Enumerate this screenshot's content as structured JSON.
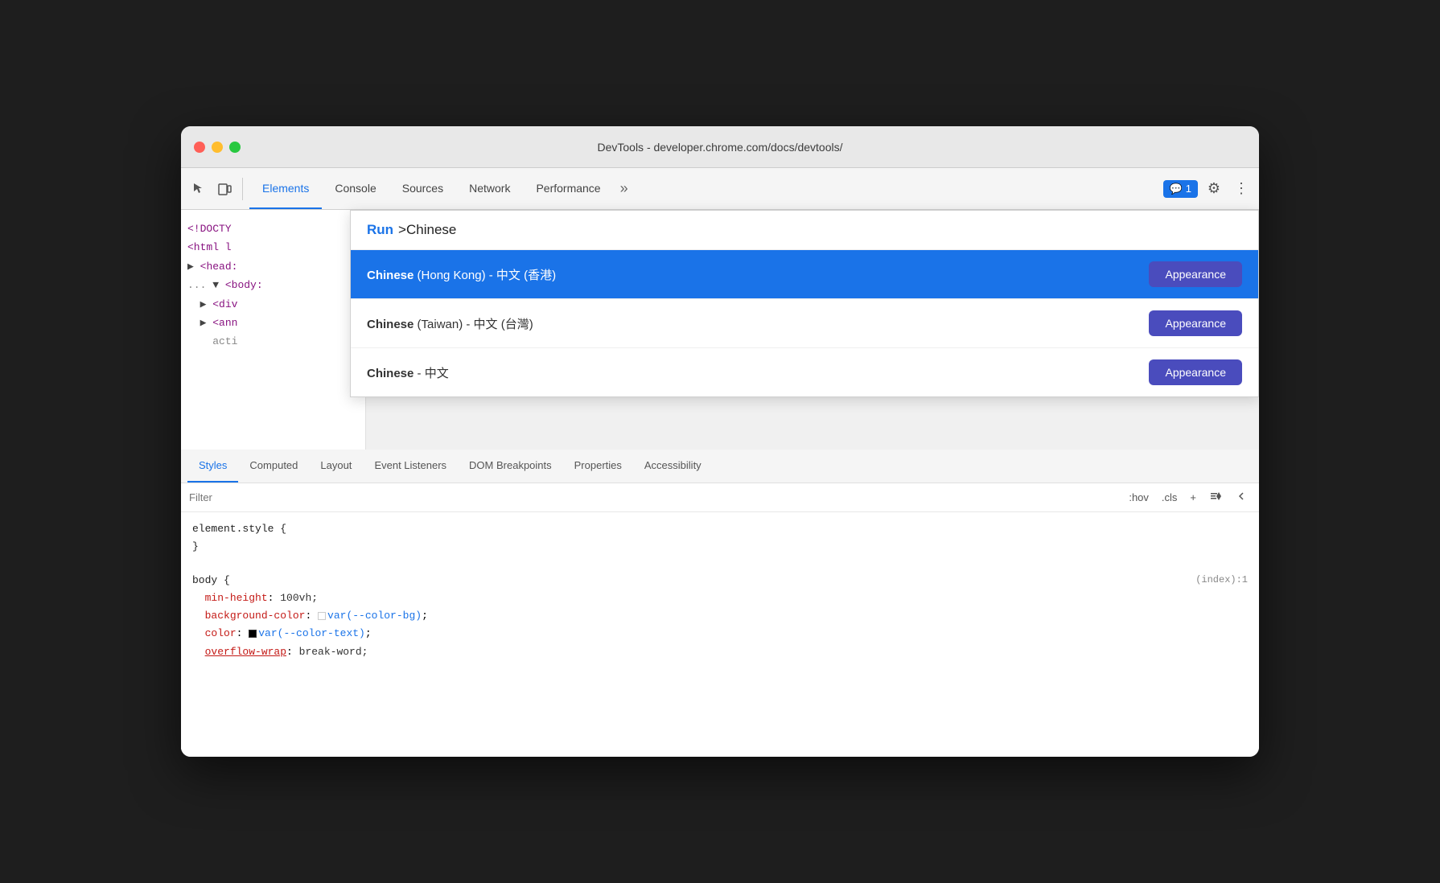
{
  "window": {
    "title": "DevTools - developer.chrome.com/docs/devtools/"
  },
  "toolbar": {
    "tabs": [
      {
        "label": "Elements",
        "active": true
      },
      {
        "label": "Console",
        "active": false
      },
      {
        "label": "Sources",
        "active": false
      },
      {
        "label": "Network",
        "active": false
      },
      {
        "label": "Performance",
        "active": false
      }
    ],
    "more_label": "»",
    "notification": "1",
    "settings_icon": "⚙",
    "menu_icon": "⋮"
  },
  "autocomplete": {
    "run_label": "Run",
    "query": ">Chinese",
    "results": [
      {
        "bold": "Chinese",
        "rest": " (Hong Kong) - 中文 (香港)",
        "appearance_label": "Appearance",
        "selected": true
      },
      {
        "bold": "Chinese",
        "rest": " (Taiwan) - 中文 (台灣)",
        "appearance_label": "Appearance",
        "selected": false
      },
      {
        "bold": "Chinese",
        "rest": " - 中文",
        "appearance_label": "Appearance",
        "selected": false
      }
    ]
  },
  "dom": {
    "lines": [
      "<!DOCTY",
      "<html l",
      "▶ <head:",
      "... ▼ <body:",
      "  ▶ <div",
      "  ▶ <ann",
      "    acti"
    ]
  },
  "bottom_tabs": {
    "items": [
      {
        "label": "Styles",
        "active": true
      },
      {
        "label": "Computed",
        "active": false
      },
      {
        "label": "Layout",
        "active": false
      },
      {
        "label": "Event Listeners",
        "active": false
      },
      {
        "label": "DOM Breakpoints",
        "active": false
      },
      {
        "label": "Properties",
        "active": false
      },
      {
        "label": "Accessibility",
        "active": false
      }
    ]
  },
  "styles": {
    "filter_placeholder": "Filter",
    "hov_label": ":hov",
    "cls_label": ".cls",
    "plus_label": "+",
    "block1": {
      "selector": "element.style {",
      "close": "}"
    },
    "block2": {
      "selector": "body {",
      "index": "(index):1",
      "properties": [
        {
          "name": "min-height",
          "value": "100vh;"
        },
        {
          "name": "background-color",
          "value": "var(--color-bg);",
          "has_swatch": true,
          "swatch": "white"
        },
        {
          "name": "color",
          "value": "var(--color-text);",
          "has_swatch": true,
          "swatch": "black"
        },
        {
          "name": "overflow-wrap",
          "value": "break-word;",
          "underline": true
        }
      ]
    }
  }
}
